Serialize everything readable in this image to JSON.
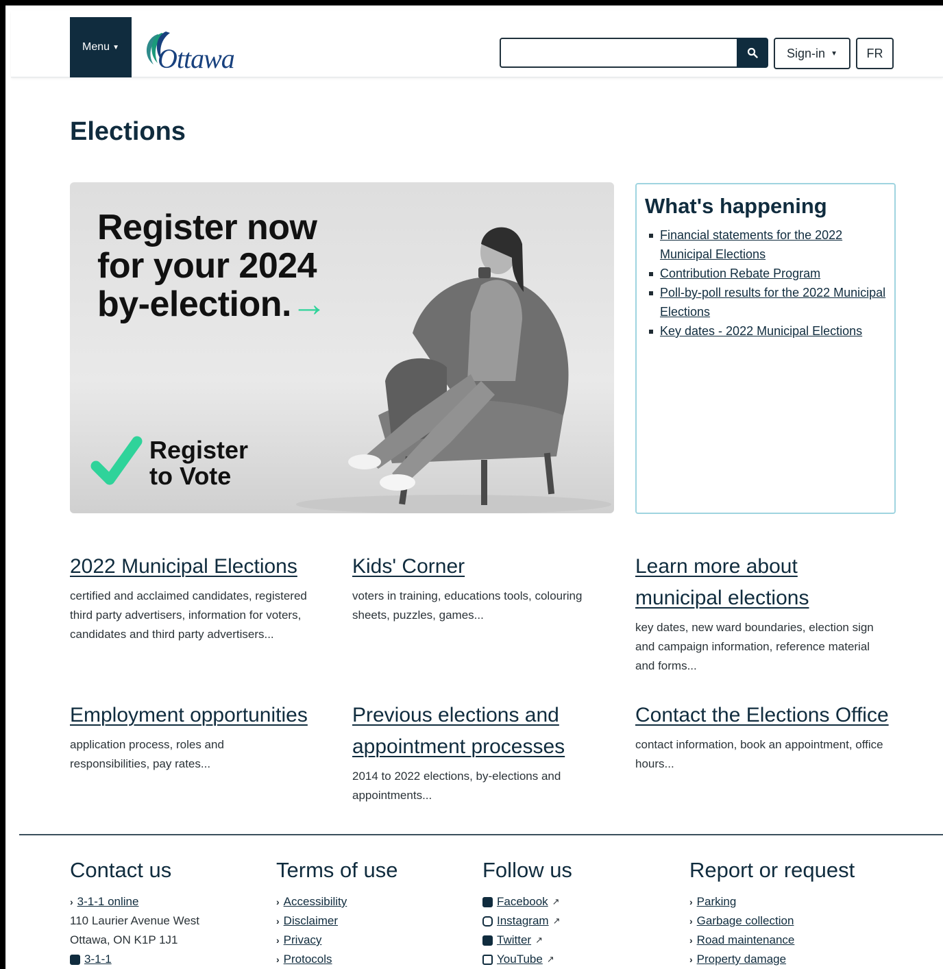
{
  "header": {
    "menu_label": "Menu",
    "logo_text": "Ottawa",
    "search_placeholder": "",
    "signin_label": "Sign-in",
    "language_label": "FR"
  },
  "page": {
    "title": "Elections"
  },
  "hero": {
    "headline": [
      "Register now",
      "for your 2024",
      "by-election."
    ],
    "arrow": "→",
    "register_lines": [
      "Register",
      "to Vote"
    ]
  },
  "whats_happening": {
    "title": "What's happening",
    "links": [
      "Financial statements for the 2022 Municipal Elections",
      "Contribution Rebate Program",
      "Poll-by-poll results for the 2022 Municipal Elections",
      "Key dates - 2022 Municipal Elections"
    ]
  },
  "cards": [
    {
      "title": "2022 Municipal Elections",
      "desc": "certified and acclaimed candidates, registered third party advertisers, information for voters, candidates and third party advertisers..."
    },
    {
      "title": "Kids' Corner",
      "desc": "voters in training, educations tools, colouring sheets, puzzles, games..."
    },
    {
      "title": "Learn more about municipal elections",
      "desc": "key dates, new ward boundaries, election sign and campaign information, reference material and forms..."
    },
    {
      "title": "Employment opportunities",
      "desc": "application process, roles and responsibilities, pay rates..."
    },
    {
      "title": "Previous elections and appointment processes",
      "desc": "2014 to 2022 elections, by-elections and appointments..."
    },
    {
      "title": "Contact the Elections Office",
      "desc": "contact information, book an appointment, office hours..."
    }
  ],
  "footer": {
    "contact": {
      "title": "Contact us",
      "link": "3-1-1 online",
      "address1": "110 Laurier Avenue West",
      "address2": "Ottawa, ON K1P 1J1",
      "phone": "3-1-1"
    },
    "terms": {
      "title": "Terms of use",
      "links": [
        "Accessibility",
        "Disclaimer",
        "Privacy",
        "Protocols"
      ]
    },
    "follow": {
      "title": "Follow us",
      "links": [
        {
          "label": "Facebook",
          "icon": "facebook-icon"
        },
        {
          "label": "Instagram",
          "icon": "instagram-icon"
        },
        {
          "label": "Twitter",
          "icon": "twitter-icon"
        },
        {
          "label": "YouTube",
          "icon": "youtube-icon"
        }
      ]
    },
    "report": {
      "title": "Report or request",
      "links": [
        "Parking",
        "Garbage collection",
        "Road maintenance",
        "Property damage"
      ]
    }
  },
  "colors": {
    "brand_dark": "#102c3e",
    "accent_green": "#2fd39a",
    "box_border": "#9fd4e0"
  }
}
